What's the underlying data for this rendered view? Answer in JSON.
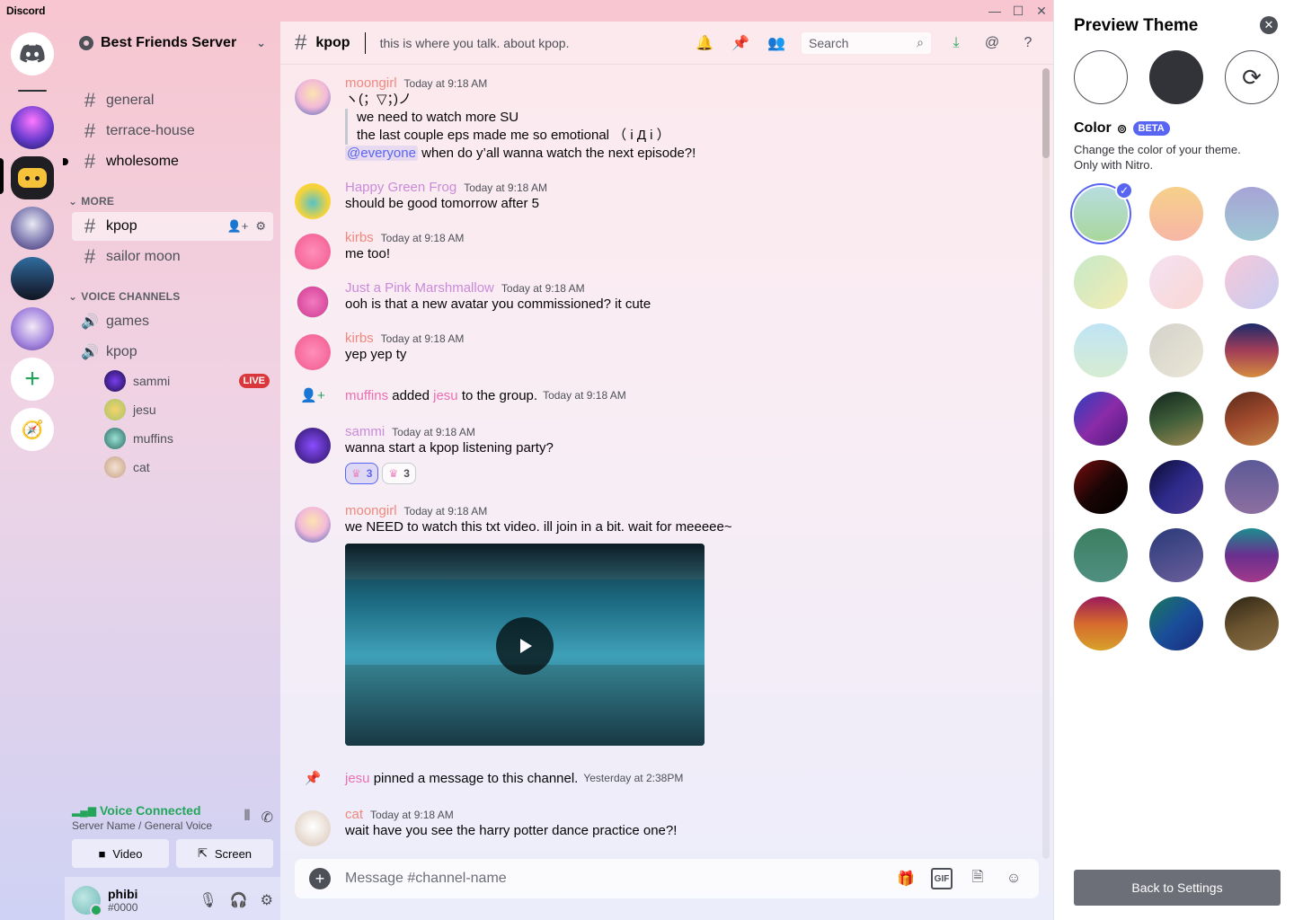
{
  "app": {
    "title": "Discord"
  },
  "server": {
    "name": "Best Friends Server"
  },
  "channels": {
    "top": [
      "general",
      "terrace-house",
      "wholesome"
    ],
    "more_label": "MORE",
    "more": [
      "kpop",
      "sailor moon"
    ],
    "voice_label": "VOICE CHANNELS",
    "voice": [
      "games",
      "kpop"
    ],
    "voice_users": [
      {
        "name": "sammi",
        "badge": "LIVE"
      },
      {
        "name": "jesu"
      },
      {
        "name": "muffins"
      },
      {
        "name": "cat"
      }
    ]
  },
  "voice_panel": {
    "status": "Voice Connected",
    "location": "Server Name / General Voice",
    "video_label": "Video",
    "screen_label": "Screen"
  },
  "user": {
    "name": "phibi",
    "tag": "#0000"
  },
  "chat": {
    "channel": "kpop",
    "topic": "this is where you talk. about kpop.",
    "search_placeholder": "Search",
    "composer_placeholder": "Message #channel-name",
    "gif_label": "GIF"
  },
  "messages": [
    {
      "author": "moongirl",
      "color": "#f0887e",
      "ts": "Today at 9:18 AM",
      "line1": "ヽ(；▽；)ノ",
      "quote1": "we need to watch more SU",
      "quote2": "the last couple eps made me so emotional （ i Д i ）",
      "mention": "@everyone",
      "rest": " when do y’all wanna watch the next episode?!"
    },
    {
      "author": "Happy Green Frog",
      "color": "#c98bd9",
      "ts": "Today at 9:18 AM",
      "text": "should be good tomorrow after 5"
    },
    {
      "author": "kirbs",
      "color": "#f0887e",
      "ts": "Today at 9:18 AM",
      "text": "me too!"
    },
    {
      "author": "Just a Pink Marshmallow",
      "color": "#c98bd9",
      "ts": "Today at 9:18 AM",
      "text": "ooh is that a new avatar you commissioned? it cute"
    },
    {
      "author": "kirbs",
      "color": "#f0887e",
      "ts": "Today at 9:18 AM",
      "text": "yep yep ty"
    },
    {
      "author": "sammi",
      "color": "#c98bd9",
      "ts": "Today at 9:18 AM",
      "text": "wanna start a kpop listening party?",
      "reactions": [
        "3",
        "3"
      ]
    },
    {
      "author": "moongirl",
      "color": "#f0887e",
      "ts": "Today at 9:18 AM",
      "text": "we NEED to watch this txt video. ill join in a bit. wait for meeeee~"
    },
    {
      "author": "cat",
      "color": "#f0887e",
      "ts": "Today at 9:18 AM",
      "text": "wait have you see the harry potter dance practice one?!"
    }
  ],
  "system": {
    "added": {
      "actor": "muffins",
      "verb": " added ",
      "target": "jesu",
      "suffix": " to the group.",
      "ts": "Today at 9:18 AM"
    },
    "pinned": {
      "actor": "jesu",
      "text": " pinned a message to this channel.",
      "ts": "Yesterday at 2:38PM"
    }
  },
  "panel": {
    "title": "Preview Theme",
    "color_label": "Color",
    "beta": "BETA",
    "desc1": "Change the color of your theme.",
    "desc2": "Only with Nitro.",
    "back_label": "Back to Settings",
    "selected_index": 0,
    "swatches": [
      "linear-gradient(180deg,#b8dde0,#a8d79c)",
      "linear-gradient(180deg,#f6d08a,#f7b6a6)",
      "linear-gradient(180deg,#a7a4d6,#9ec8d3)",
      "linear-gradient(135deg,#c6e9c9,#f4ecb2)",
      "linear-gradient(135deg,#f3e2f2,#fbd7d3)",
      "linear-gradient(135deg,#f6c8d8,#c7cdf3)",
      "linear-gradient(180deg,#bfe4f5,#d6ecd2)",
      "linear-gradient(135deg,#d3d2cb,#ebe6d6)",
      "linear-gradient(180deg,#1b2a6b,#a23d58,#d48c3e)",
      "linear-gradient(135deg,#2a3fbf,#8b2ba8,#4c1a7d)",
      "linear-gradient(160deg,#11241c,#3f5e39,#9e8752)",
      "linear-gradient(160deg,#5a2a1a,#a14a2d,#c48447)",
      "linear-gradient(135deg,#7a0d0d,#1a0505,#000)",
      "linear-gradient(135deg,#0a0b2e,#2d2a8a,#4e3b92)",
      "linear-gradient(180deg,#5c5a98,#8d6fa0)",
      "linear-gradient(180deg,#3b7f62,#4f8f80)",
      "linear-gradient(160deg,#2a3a7a,#6b5f9b)",
      "linear-gradient(180deg,#1d8d8f,#6a2f8e,#a23a8b)",
      "linear-gradient(180deg,#9a1a5a,#d56a2e,#d8a12b)",
      "linear-gradient(135deg,#1a7a5a,#1a4e9a,#1a2a7a)",
      "linear-gradient(160deg,#2d2414,#6b5430,#8a7048)"
    ]
  },
  "colors": {
    "accent": "#5865f2",
    "green": "#23a55a",
    "live": "#da373c"
  }
}
